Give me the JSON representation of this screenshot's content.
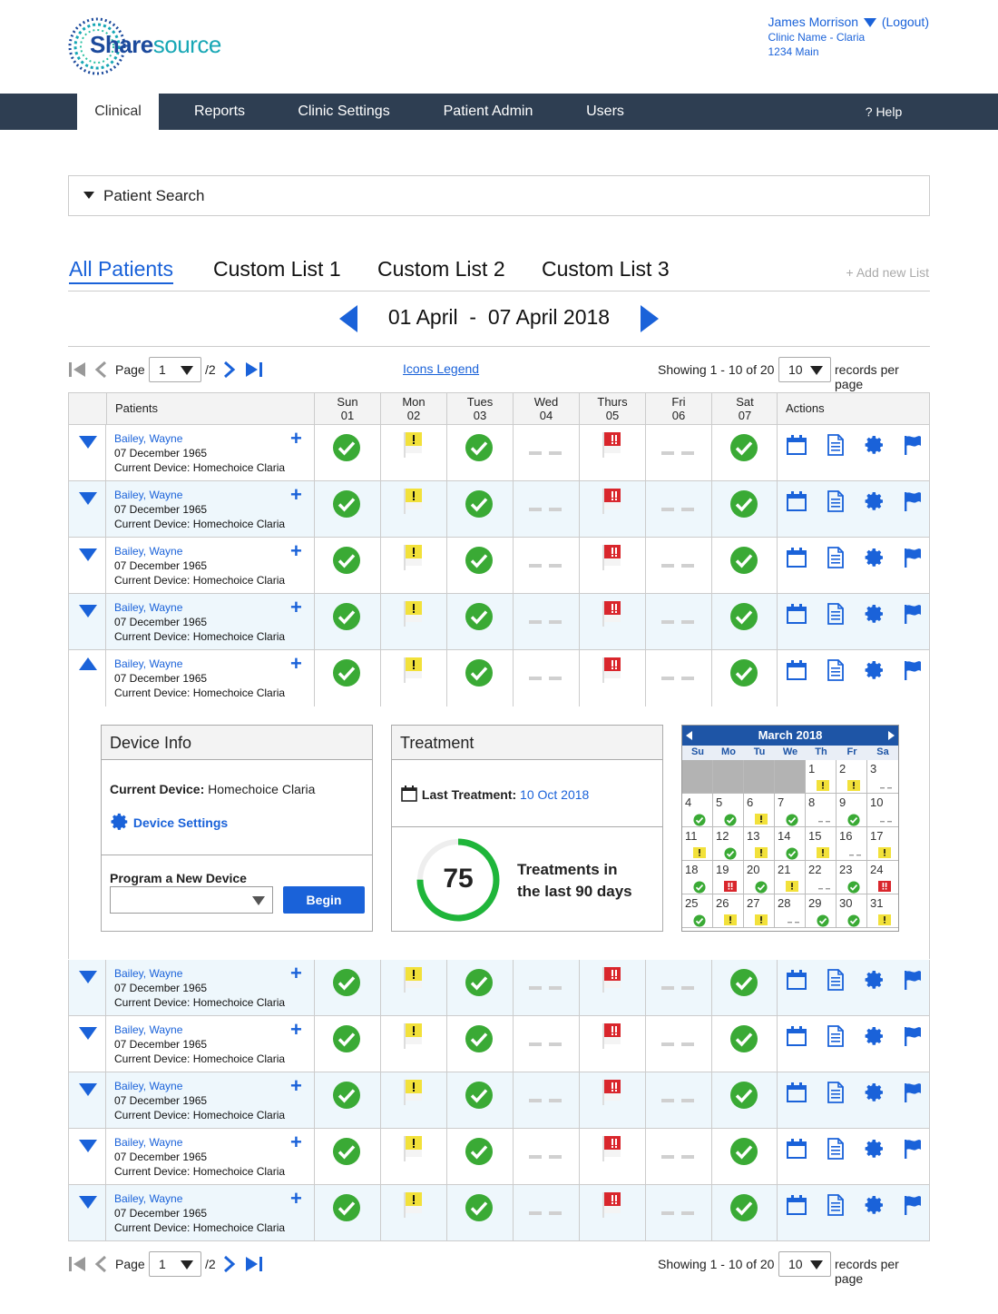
{
  "app": {
    "logo_part1": "Share",
    "logo_part2": "source"
  },
  "user": {
    "name": "James Morrison",
    "logout": "(Logout)",
    "clinic": "Clinic Name - Claria",
    "address": "1234 Main"
  },
  "nav": {
    "items": [
      "Clinical",
      "Reports",
      "Clinic Settings",
      "Patient Admin",
      "Users"
    ],
    "help": "? Help"
  },
  "search": {
    "label": "Patient Search"
  },
  "tabs": [
    "All Patients",
    "Custom List 1",
    "Custom List 2",
    "Custom List 3"
  ],
  "add_list": "+ Add new List",
  "date_range": "01 April  -  07 April 2018",
  "pager": {
    "page_label": "Page",
    "page_value": "1",
    "page_total": "/2",
    "legend": "Icons Legend",
    "showing": "Showing 1 - 10 of 20",
    "per_page_value": "10",
    "per_page_label": "records per page"
  },
  "table": {
    "patients_header": "Patients",
    "actions_header": "Actions",
    "days": [
      {
        "name": "Sun",
        "num": "01"
      },
      {
        "name": "Mon",
        "num": "02"
      },
      {
        "name": "Tues",
        "num": "03"
      },
      {
        "name": "Wed",
        "num": "04"
      },
      {
        "name": "Thurs",
        "num": "05"
      },
      {
        "name": "Fri",
        "num": "06"
      },
      {
        "name": "Sat",
        "num": "07"
      }
    ],
    "day_status": [
      "ok",
      "yellow-flag",
      "ok",
      "none",
      "red-flag",
      "none",
      "ok"
    ],
    "rows": [
      {
        "name": "Bailey, Wayne",
        "dob": "07 December 1965",
        "device": "Current Device: Homechoice Claria"
      },
      {
        "name": "Bailey, Wayne",
        "dob": "07 December 1965",
        "device": "Current Device: Homechoice Claria"
      },
      {
        "name": "Bailey, Wayne",
        "dob": "07 December 1965",
        "device": "Current Device: Homechoice Claria"
      },
      {
        "name": "Bailey, Wayne",
        "dob": "07 December 1965",
        "device": "Current Device: Homechoice Claria"
      },
      {
        "name": "Bailey, Wayne",
        "dob": "07 December 1965",
        "device": "Current Device: Homechoice Claria"
      },
      {
        "name": "Bailey, Wayne",
        "dob": "07 December 1965",
        "device": "Current Device: Homechoice Claria"
      },
      {
        "name": "Bailey, Wayne",
        "dob": "07 December 1965",
        "device": "Current Device: Homechoice Claria"
      },
      {
        "name": "Bailey, Wayne",
        "dob": "07 December 1965",
        "device": "Current Device: Homechoice Claria"
      },
      {
        "name": "Bailey, Wayne",
        "dob": "07 December 1965",
        "device": "Current Device: Homechoice Claria"
      },
      {
        "name": "Bailey, Wayne",
        "dob": "07 December 1965",
        "device": "Current Device: Homechoice Claria"
      }
    ],
    "expanded_row": 4
  },
  "device_info": {
    "title": "Device Info",
    "current_label": "Current Device:",
    "current_value": "Homechoice Claria",
    "settings": "Device Settings",
    "program_label": "Program a New Device",
    "begin": "Begin"
  },
  "treatment": {
    "title": "Treatment",
    "last_label": "Last Treatment:",
    "last_value": "10 Oct 2018",
    "count": "75",
    "progress": 0.75,
    "count_label_1": "Treatments in",
    "count_label_2": "the last 90 days"
  },
  "calendar": {
    "title": "March 2018",
    "dow": [
      "Su",
      "Mo",
      "Tu",
      "We",
      "Th",
      "Fr",
      "Sa"
    ],
    "leading_blanks": 4,
    "days": [
      {
        "d": "1",
        "s": "yellow"
      },
      {
        "d": "2",
        "s": "yellow"
      },
      {
        "d": "3",
        "s": "none"
      },
      {
        "d": "4",
        "s": "ok"
      },
      {
        "d": "5",
        "s": "ok"
      },
      {
        "d": "6",
        "s": "yellow"
      },
      {
        "d": "7",
        "s": "ok"
      },
      {
        "d": "8",
        "s": "none"
      },
      {
        "d": "9",
        "s": "ok"
      },
      {
        "d": "10",
        "s": "none"
      },
      {
        "d": "11",
        "s": "yellow"
      },
      {
        "d": "12",
        "s": "ok"
      },
      {
        "d": "13",
        "s": "yellow"
      },
      {
        "d": "14",
        "s": "ok"
      },
      {
        "d": "15",
        "s": "yellow"
      },
      {
        "d": "16",
        "s": "none"
      },
      {
        "d": "17",
        "s": "yellow"
      },
      {
        "d": "18",
        "s": "ok"
      },
      {
        "d": "19",
        "s": "red"
      },
      {
        "d": "20",
        "s": "ok"
      },
      {
        "d": "21",
        "s": "yellow"
      },
      {
        "d": "22",
        "s": "none"
      },
      {
        "d": "23",
        "s": "ok"
      },
      {
        "d": "24",
        "s": "red"
      },
      {
        "d": "25",
        "s": "ok"
      },
      {
        "d": "26",
        "s": "yellow"
      },
      {
        "d": "27",
        "s": "yellow"
      },
      {
        "d": "28",
        "s": "none"
      },
      {
        "d": "29",
        "s": "ok"
      },
      {
        "d": "30",
        "s": "ok"
      },
      {
        "d": "31",
        "s": "yellow"
      }
    ]
  },
  "colors": {
    "accent": "#1a62d9",
    "nav_bg": "#2e3e52",
    "ok_green": "#3aaa35",
    "flag_yellow": "#f2e13a",
    "flag_red": "#d9262c",
    "progress_green": "#1fb53a"
  }
}
